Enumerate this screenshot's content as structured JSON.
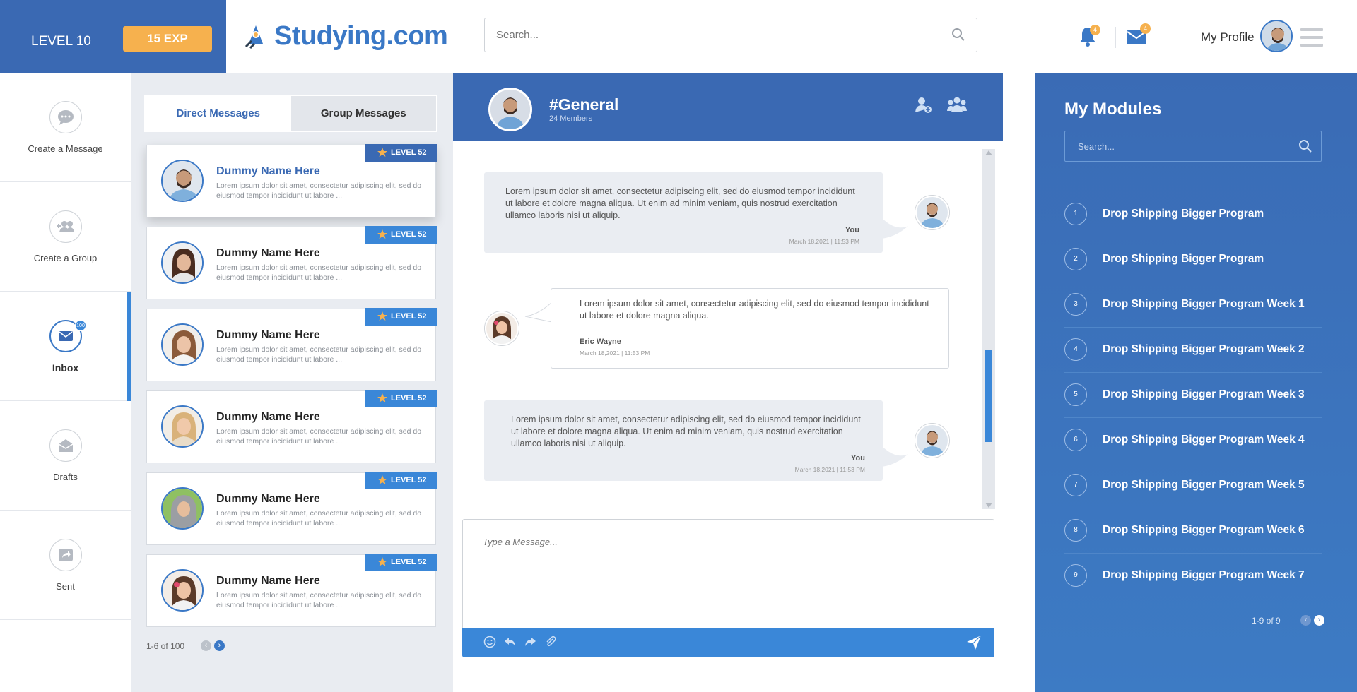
{
  "header": {
    "level_label": "LEVEL 10",
    "exp_label": "15 EXP",
    "logo_text": "Studying.com",
    "search_placeholder": "Search...",
    "bell_count": "4",
    "mail_count": "4",
    "profile_label": "My Profile",
    "accent": "#3a69b3",
    "exp_color": "#f6b14e"
  },
  "nav": {
    "items": [
      {
        "label": "Create a Message",
        "icon": "chat-bubble-icon"
      },
      {
        "label": "Create a Group",
        "icon": "add-group-icon"
      },
      {
        "label": "Inbox",
        "icon": "mail-icon",
        "badge": "100"
      },
      {
        "label": "Drafts",
        "icon": "open-envelope-icon"
      },
      {
        "label": "Sent",
        "icon": "forward-icon"
      }
    ]
  },
  "messages": {
    "tabs": [
      "Direct Messages",
      "Group Messages"
    ],
    "level_badge": "LEVEL 52",
    "cards": [
      {
        "name": "Dummy Name Here",
        "preview": "Lorem ipsum dolor sit amet, consectetur adipiscing elit, sed do eiusmod tempor incididunt ut labore ..."
      },
      {
        "name": "Dummy Name Here",
        "preview": "Lorem ipsum dolor sit amet, consectetur adipiscing elit, sed do eiusmod tempor incididunt ut labore ..."
      },
      {
        "name": "Dummy Name Here",
        "preview": "Lorem ipsum dolor sit amet, consectetur adipiscing elit, sed do eiusmod tempor incididunt ut labore ..."
      },
      {
        "name": "Dummy Name Here",
        "preview": "Lorem ipsum dolor sit amet, consectetur adipiscing elit, sed do eiusmod tempor incididunt ut labore ..."
      },
      {
        "name": "Dummy Name Here",
        "preview": "Lorem ipsum dolor sit amet, consectetur adipiscing elit, sed do eiusmod tempor incididunt ut labore ..."
      },
      {
        "name": "Dummy Name Here",
        "preview": "Lorem ipsum dolor sit amet, consectetur adipiscing elit, sed do eiusmod tempor incididunt ut labore ..."
      }
    ],
    "pager": "1-6 of 100"
  },
  "chat": {
    "channel": "#General",
    "members": "24 Members",
    "messages": [
      {
        "text": "Lorem ipsum dolor sit amet, consectetur adipiscing elit, sed do eiusmod tempor incididunt ut labore et dolore magna aliqua. Ut enim ad minim veniam, quis nostrud exercitation ullamco laboris nisi ut aliquip.",
        "who": "You",
        "time": "March 18,2021 | 11:53 PM"
      },
      {
        "text": "Lorem ipsum dolor sit amet, consectetur adipiscing elit, sed do eiusmod tempor incididunt ut labore et dolore magna aliqua.",
        "who": "Eric Wayne",
        "time": "March 18,2021 | 11:53 PM"
      },
      {
        "text": "Lorem ipsum dolor sit amet, consectetur adipiscing elit, sed do eiusmod tempor incididunt ut labore et dolore magna aliqua. Ut enim ad minim veniam, quis nostrud exercitation ullamco laboris nisi ut aliquip.",
        "who": "You",
        "time": "March 18,2021 | 11:53 PM"
      }
    ],
    "compose_placeholder": "Type a Message..."
  },
  "modules": {
    "title": "My Modules",
    "search_placeholder": "Search...",
    "items": [
      {
        "num": "1",
        "label": "Drop Shipping Bigger Program"
      },
      {
        "num": "2",
        "label": "Drop Shipping Bigger Program"
      },
      {
        "num": "3",
        "label": "Drop Shipping Bigger Program Week 1"
      },
      {
        "num": "4",
        "label": "Drop Shipping Bigger Program Week 2"
      },
      {
        "num": "5",
        "label": "Drop Shipping Bigger Program Week 3"
      },
      {
        "num": "6",
        "label": "Drop Shipping Bigger Program Week 4"
      },
      {
        "num": "7",
        "label": "Drop Shipping Bigger Program Week 5"
      },
      {
        "num": "8",
        "label": "Drop Shipping Bigger Program Week 6"
      },
      {
        "num": "9",
        "label": "Drop Shipping Bigger Program Week 7"
      }
    ],
    "pager": "1-9 of 9"
  }
}
